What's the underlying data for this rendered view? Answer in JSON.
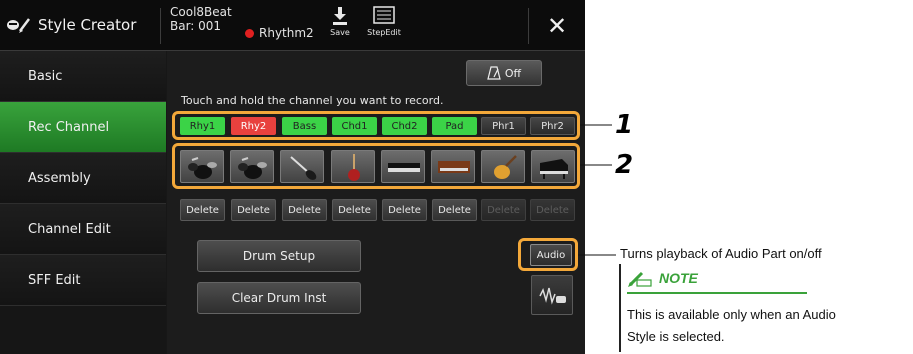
{
  "header": {
    "app_title": "Style Creator",
    "style_name": "Cool8Beat",
    "bar_label": "Bar: 001",
    "rec_label": "Rhythm2",
    "save_label": "Save",
    "stepedit_label": "StepEdit",
    "close_glyph": "✕",
    "rec_color": "#e02020"
  },
  "sidebar": {
    "items": [
      {
        "label": "Basic",
        "active": false
      },
      {
        "label": "Rec Channel",
        "active": true
      },
      {
        "label": "Assembly",
        "active": false
      },
      {
        "label": "Channel Edit",
        "active": false
      },
      {
        "label": "SFF Edit",
        "active": false
      }
    ],
    "active_color": "#2d9433"
  },
  "main": {
    "metronome_label": "Off",
    "hint": "Touch and hold the channel you want to record.",
    "channels": [
      {
        "label": "Rhy1",
        "state": "green"
      },
      {
        "label": "Rhy2",
        "state": "red"
      },
      {
        "label": "Bass",
        "state": "green"
      },
      {
        "label": "Chd1",
        "state": "green"
      },
      {
        "label": "Chd2",
        "state": "green"
      },
      {
        "label": "Pad",
        "state": "green"
      },
      {
        "label": "Phr1",
        "state": "off"
      },
      {
        "label": "Phr2",
        "state": "off"
      }
    ],
    "instrument_icons": [
      "drum-kit-icon",
      "drum-kit-icon",
      "electric-bass-icon",
      "electric-guitar-icon",
      "piano-keys-icon",
      "organ-keys-icon",
      "acoustic-guitar-icon",
      "grand-piano-icon"
    ],
    "delete_label": "Delete",
    "delete_enabled": [
      true,
      true,
      true,
      true,
      true,
      true,
      false,
      false
    ],
    "drum_setup_label": "Drum Setup",
    "clear_drum_label": "Clear Drum Inst",
    "audio_label": "Audio"
  },
  "callouts": {
    "one": "1",
    "two": "2",
    "audio_desc": "Turns playback of Audio Part on/off",
    "note_title": "NOTE",
    "note_text_1": "This is available only when an Audio",
    "note_text_2": "Style is selected.",
    "highlight_color": "#f3a83a",
    "note_color": "#3aa23a"
  }
}
